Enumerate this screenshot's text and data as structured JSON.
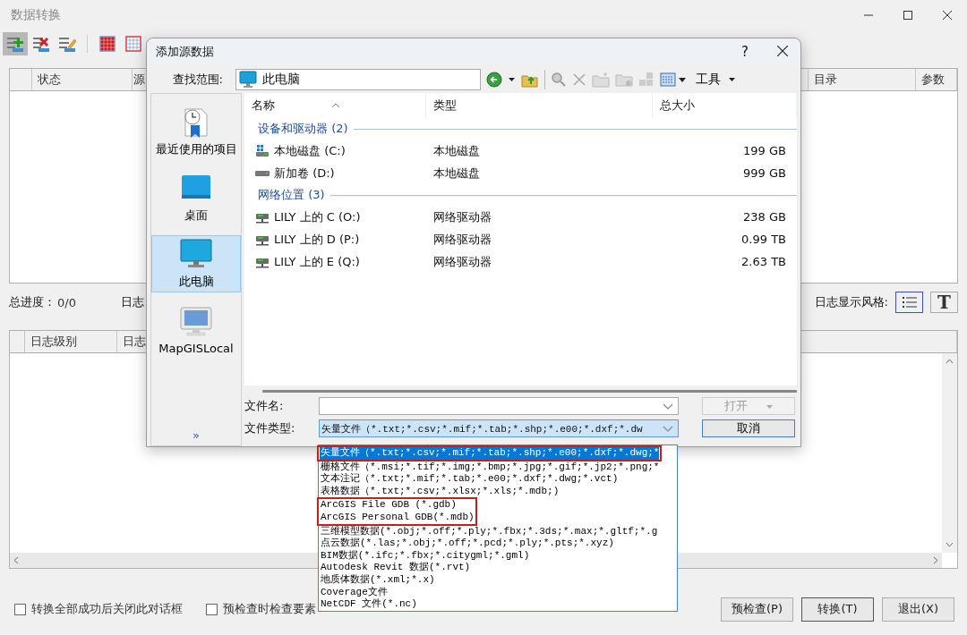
{
  "window": {
    "title": "数据转换"
  },
  "toolbar": [
    {
      "kind": "add",
      "pressed": true
    },
    {
      "kind": "remove",
      "pressed": false
    },
    {
      "kind": "edit",
      "pressed": false
    },
    {
      "kind": "grid-fill",
      "pressed": false
    },
    {
      "kind": "grid-empty",
      "pressed": false
    }
  ],
  "source_table": {
    "columns": [
      "状态",
      "源",
      "目录",
      "参数"
    ]
  },
  "progress": {
    "label": "总进度：",
    "value": "0/0"
  },
  "log_level_label": "日志",
  "log_style": {
    "label": "日志显示风格:",
    "options": [
      {
        "kind": "list",
        "selected": true
      },
      {
        "kind": "text",
        "glyph": "T",
        "selected": false
      }
    ]
  },
  "log_table": {
    "columns": [
      "日志级别",
      "日志"
    ]
  },
  "options": [
    {
      "label": "转换全部成功后关闭此对话框",
      "checked": false
    },
    {
      "label": "预检查时检查要素",
      "checked": false
    }
  ],
  "buttons": [
    {
      "label": "预检查(P)",
      "default": false
    },
    {
      "label": "转换(T)",
      "default": true
    },
    {
      "label": "退出(X)",
      "default": false
    }
  ],
  "dialog": {
    "title": "添加源数据",
    "help": "?",
    "look_in": {
      "label": "查找范围:",
      "value": "此电脑"
    },
    "tools_label": "工具",
    "places": [
      {
        "label": "最近使用的项目",
        "kind": "recent",
        "selected": false
      },
      {
        "label": "桌面",
        "kind": "desktop",
        "selected": false
      },
      {
        "label": "此电脑",
        "kind": "computer",
        "selected": true
      },
      {
        "label": "MapGISLocal",
        "kind": "local",
        "selected": false
      }
    ],
    "more": "»",
    "columns": [
      "名称",
      "类型",
      "总大小"
    ],
    "groups": [
      {
        "title": "设备和驱动器 (2)",
        "items": [
          {
            "name": "本地磁盘 (C:)",
            "type": "本地磁盘",
            "size": "199 GB",
            "kind": "system"
          },
          {
            "name": "新加卷 (D:)",
            "type": "本地磁盘",
            "size": "999 GB",
            "kind": "disk"
          }
        ]
      },
      {
        "title": "网络位置 (3)",
        "items": [
          {
            "name": "LILY 上的 C (O:)",
            "type": "网络驱动器",
            "size": "238 GB",
            "kind": "network"
          },
          {
            "name": "LILY 上的 D (P:)",
            "type": "网络驱动器",
            "size": "0.99 TB",
            "kind": "network"
          },
          {
            "name": "LILY 上的 E (Q:)",
            "type": "网络驱动器",
            "size": "2.63 TB",
            "kind": "network"
          }
        ]
      }
    ],
    "file_name": {
      "label": "文件名:"
    },
    "file_type": {
      "label": "文件类型:",
      "value": "矢量文件（*.txt;*.csv;*.mif;*.tab;*.shp;*.e00;*.dxf;*.dw",
      "expanded": true,
      "options": [
        {
          "label": "矢量文件（*.txt;*.csv;*.mif;*.tab;*.shp;*.e00;*.dxf;*.dwg;*",
          "selected": true,
          "marked": true
        },
        {
          "label": "栅格文件（*.msi;*.tif;*.img;*.bmp;*.jpg;*.gif;*.jp2;*.png;*",
          "selected": false,
          "marked": false
        },
        {
          "label": "文本注记（*.txt;*.mif;*.tab;*.e00;*.dxf;*.dwg;*.vct)",
          "selected": false,
          "marked": false
        },
        {
          "label": "表格数据（*.txt;*.csv;*.xlsx;*.xls;*.mdb;)",
          "selected": false,
          "marked": false
        },
        {
          "label": "ArcGIS File GDB (*.gdb)",
          "selected": false,
          "marked": true
        },
        {
          "label": "ArcGIS Personal GDB(*.mdb)",
          "selected": false,
          "marked": true
        },
        {
          "label": "三维模型数据(*.obj;*.off;*.ply;*.fbx;*.3ds;*.max;*.gltf;*.g",
          "selected": false,
          "marked": false
        },
        {
          "label": "点云数据(*.las;*.obj;*.off;*.pcd;*.ply;*.pts;*.xyz)",
          "selected": false,
          "marked": false
        },
        {
          "label": "BIM数据(*.ifc;*.fbx;*.citygml;*.gml)",
          "selected": false,
          "marked": false
        },
        {
          "label": "Autodesk Revit 数据(*.rvt)",
          "selected": false,
          "marked": false
        },
        {
          "label": "地质体数据(*.xml;*.x)",
          "selected": false,
          "marked": false
        },
        {
          "label": "Coverage文件",
          "selected": false,
          "marked": false
        },
        {
          "label": "NetCDF 文件(*.nc)",
          "selected": false,
          "marked": false
        }
      ]
    },
    "open_button": {
      "label": "打开",
      "disabled": true
    },
    "cancel_button": {
      "label": "取消"
    }
  }
}
